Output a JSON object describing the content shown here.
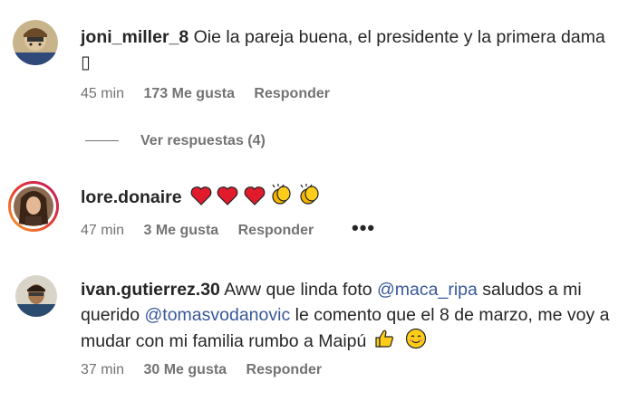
{
  "comments": [
    {
      "username": "joni_miller_8",
      "text": "Oie la pareja buena, el presidente y la primera dama ▯",
      "time": "45 min",
      "likes": "173 Me gusta",
      "reply": "Responder",
      "view_replies": "Ver respuestas (4)"
    },
    {
      "username": "lore.donaire",
      "emojis": [
        "red-heart",
        "red-heart",
        "red-heart",
        "clapping-hands",
        "clapping-hands"
      ],
      "time": "47 min",
      "likes": "3 Me gusta",
      "reply": "Responder",
      "more": "•••"
    },
    {
      "username": "ivan.gutierrez.30",
      "text_a": "Aww que linda foto",
      "mention_1": "@maca_ripa",
      "text_b": "saludos a mi querido",
      "mention_2": "@tomasvodanovic",
      "text_c": "le comento que el 8 de marzo, me voy a mudar con mi familia rumbo a Maipú",
      "emojis": [
        "thumbs-up",
        "smiling-face"
      ],
      "time": "37 min",
      "likes": "30 Me gusta",
      "reply": "Responder"
    }
  ],
  "colors": {
    "text": "#262626",
    "secondary": "#737373",
    "mention": "#385898",
    "story_ring_start": "#f9a825",
    "story_ring_end": "#c2185b"
  }
}
